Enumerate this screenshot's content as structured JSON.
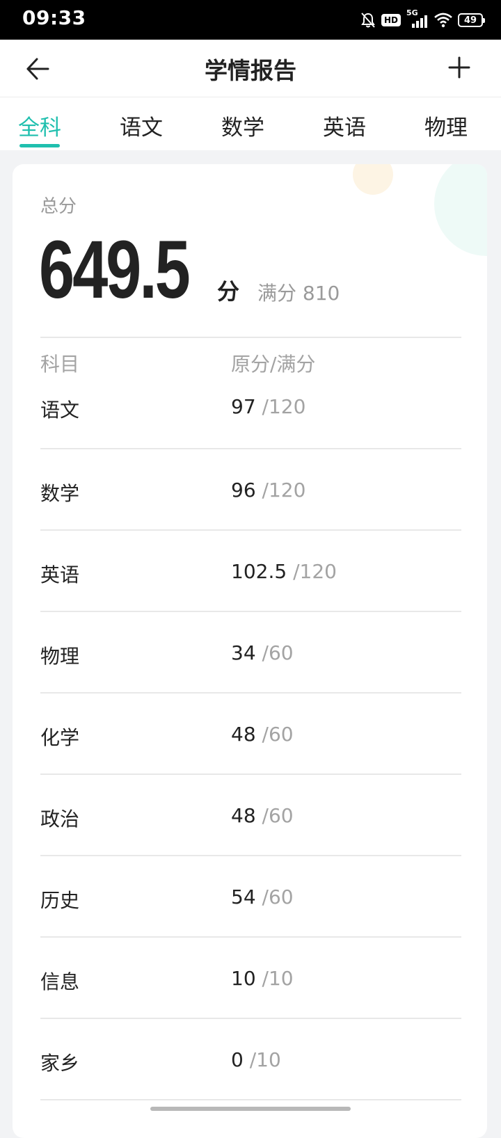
{
  "status_bar": {
    "time": "09:33",
    "hd": "HD",
    "network": "5G",
    "battery": "49",
    "icons": [
      "mute-icon",
      "hd-icon",
      "signal-icon",
      "wifi-icon",
      "battery-icon"
    ]
  },
  "header": {
    "title": "学情报告",
    "back_icon": "arrow-left-icon",
    "add_icon": "plus-icon"
  },
  "tabs": [
    {
      "label": "全科",
      "active": true
    },
    {
      "label": "语文",
      "active": false
    },
    {
      "label": "数学",
      "active": false
    },
    {
      "label": "英语",
      "active": false
    },
    {
      "label": "物理",
      "active": false
    }
  ],
  "summary": {
    "total_label": "总分",
    "total_value": "649.5",
    "unit": "分",
    "full_marks": "满分 810"
  },
  "table": {
    "headers": [
      "科目",
      "原分/满分"
    ],
    "rows": [
      {
        "subject": "语文",
        "score": "97",
        "max": " /120"
      },
      {
        "subject": "数学",
        "score": "96",
        "max": " /120"
      },
      {
        "subject": "英语",
        "score": "102.5",
        "max": " /120"
      },
      {
        "subject": "物理",
        "score": "34",
        "max": " /60"
      },
      {
        "subject": "化学",
        "score": "48",
        "max": " /60"
      },
      {
        "subject": "政治",
        "score": "48",
        "max": " /60"
      },
      {
        "subject": "历史",
        "score": "54",
        "max": " /60"
      },
      {
        "subject": "信息",
        "score": "10",
        "max": " /10"
      },
      {
        "subject": "家乡",
        "score": "0",
        "max": " /10"
      }
    ]
  },
  "colors": {
    "accent": "#1fbfae",
    "text": "#222222",
    "muted": "#a3a3a3",
    "background": "#f2f3f5"
  }
}
